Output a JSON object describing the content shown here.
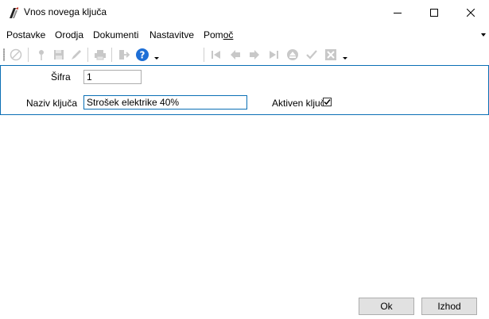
{
  "window": {
    "title": "Vnos novega ključa",
    "minimize_label": "Minimize",
    "maximize_label": "Maximize",
    "close_label": "Close"
  },
  "menu": {
    "items": [
      "Postavke",
      "Orodja",
      "Dokumenti",
      "Nastavitve",
      "Pomoč"
    ]
  },
  "toolbar": {
    "icons": [
      "cancel-icon",
      "location-pin-icon",
      "save-icon",
      "edit-icon",
      "print-icon",
      "exit-icon",
      "help-icon",
      "first-record-icon",
      "previous-record-icon",
      "next-record-icon",
      "last-record-icon",
      "eject-icon",
      "confirm-icon",
      "delete-icon"
    ]
  },
  "form": {
    "sifra_label": "Šifra",
    "sifra_value": "1",
    "naziv_label": "Naziv ključa",
    "naziv_value": "Strošek elektrike 40%",
    "aktiven_label": "Aktiven ključ",
    "aktiven_checked": true
  },
  "buttons": {
    "ok_label": "Ok",
    "izhod_label": "Izhod"
  },
  "colors": {
    "accent": "#0a6fb5",
    "disabled_icon": "#c8c8c8",
    "help_blue": "#1e6fd6"
  }
}
